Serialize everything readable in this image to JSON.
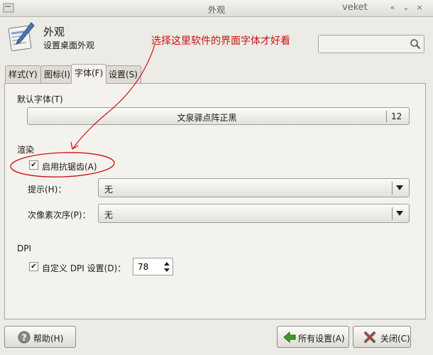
{
  "window": {
    "title": "外观",
    "app_name": "veket",
    "controls": {
      "shade": "«",
      "minimize": "⌄",
      "maximize": "⤢",
      "close": "×"
    }
  },
  "header": {
    "title": "外观",
    "subtitle": "设置桌面外观",
    "search": {
      "value": "",
      "placeholder": ""
    }
  },
  "annotation": {
    "text": "选择这里软件的界面字体才好看",
    "color": "#cc1111"
  },
  "tabs": [
    {
      "label": "样式(Y)",
      "active": false
    },
    {
      "label": "图标(I)",
      "active": false
    },
    {
      "label": "字体(F)",
      "active": true
    },
    {
      "label": "设置(S)",
      "active": false
    }
  ],
  "fonts": {
    "default_font_label": "默认字体(T)",
    "font_name": "文泉驿点阵正黑",
    "font_size": "12"
  },
  "rendering": {
    "section_label": "渲染",
    "antialias": {
      "label": "启用抗锯齿(A)",
      "checked": true
    },
    "hinting": {
      "label": "提示(H)：",
      "value": "无"
    },
    "subpixel": {
      "label": "次像素次序(P)：",
      "value": "无"
    }
  },
  "dpi": {
    "section_label": "DPI",
    "custom": {
      "label": "自定义 DPI 设置(D)：",
      "checked": true
    },
    "value": "78"
  },
  "buttons": {
    "help": "帮助(H)",
    "all_settings": "所有设置(A)",
    "close": "关闭(C)"
  },
  "colors": {
    "panel": "#f3f2ee",
    "window": "#ecebe6",
    "accent_green": "#3d9a2e",
    "close_red": "#c23a2a"
  }
}
